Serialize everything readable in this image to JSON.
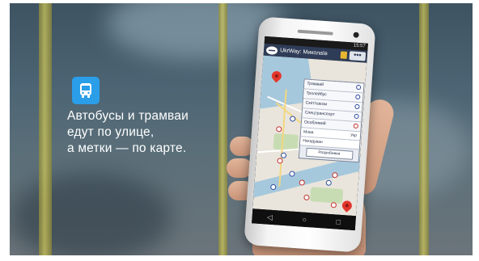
{
  "promo": {
    "caption_lines": [
      "Автобусы и трамваи",
      "едут по улице,",
      "а метки — по карте."
    ]
  },
  "phone": {
    "status_time": "15:57",
    "app_title": "UkrWay: Миколаїв",
    "menu_button": "•••",
    "transport_items": [
      {
        "label": "Трамвай"
      },
      {
        "label": "Тролейбус"
      },
      {
        "label": "Сміттєвози"
      },
      {
        "label": "Спецтранспорт"
      },
      {
        "label": "Особливий"
      }
    ],
    "language": {
      "label": "Мова",
      "value": "Укр"
    },
    "reminder": {
      "label": "Нагадуван"
    },
    "developers_button": "Розробники",
    "nav": {
      "back": "◁",
      "home": "○",
      "recent": "□"
    }
  },
  "colors": {
    "accent": "#2a9ee8",
    "appbar": "#2f3c57",
    "pin": "#e3362c"
  },
  "icons": [
    "bus-icon",
    "app-logo-icon",
    "map-pin-icon",
    "location-pin-icon"
  ]
}
